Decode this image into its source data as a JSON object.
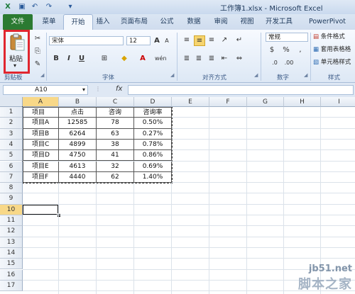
{
  "window": {
    "title": "工作簿1.xlsx - Microsoft Excel"
  },
  "quick_access": [
    "save-icon",
    "undo-icon",
    "redo-icon",
    "customize-icon"
  ],
  "tabs": [
    {
      "label": "文件"
    },
    {
      "label": "菜单"
    },
    {
      "label": "开始"
    },
    {
      "label": "插入"
    },
    {
      "label": "页面布局"
    },
    {
      "label": "公式"
    },
    {
      "label": "数据"
    },
    {
      "label": "审阅"
    },
    {
      "label": "视图"
    },
    {
      "label": "开发工具"
    },
    {
      "label": "PowerPivot"
    }
  ],
  "ribbon": {
    "paste_label": "粘贴",
    "font_name": "宋体",
    "font_size": "12",
    "number_format": "常规",
    "groups": {
      "clipboard": "剪贴板",
      "font": "字体",
      "alignment": "对齐方式",
      "number": "数字",
      "styles": "样式"
    },
    "styles_items": [
      "条件格式",
      "套用表格格",
      "单元格样式"
    ]
  },
  "formula_bar": {
    "name_box": "A10",
    "fx": "fx",
    "formula": ""
  },
  "columns": [
    "A",
    "B",
    "C",
    "D",
    "E",
    "F",
    "G",
    "H",
    "I"
  ],
  "rows": [
    "1",
    "2",
    "3",
    "4",
    "5",
    "6",
    "7",
    "8",
    "9",
    "10",
    "11",
    "12",
    "13",
    "14",
    "15",
    "16",
    "17"
  ],
  "table": {
    "headers": [
      "项目",
      "点击",
      "咨询",
      "咨询率"
    ],
    "rows": [
      [
        "项目A",
        "12585",
        "78",
        "0.50%"
      ],
      [
        "项目B",
        "6264",
        "63",
        "0.27%"
      ],
      [
        "项目C",
        "4899",
        "38",
        "0.78%"
      ],
      [
        "项目D",
        "4750",
        "41",
        "0.86%"
      ],
      [
        "项目E",
        "4613",
        "32",
        "0.69%"
      ],
      [
        "项目F",
        "4440",
        "62",
        "1.40%"
      ]
    ]
  },
  "active_cell": "A10",
  "watermark": {
    "line1": "jb51.net",
    "line2": "脚本之家"
  }
}
